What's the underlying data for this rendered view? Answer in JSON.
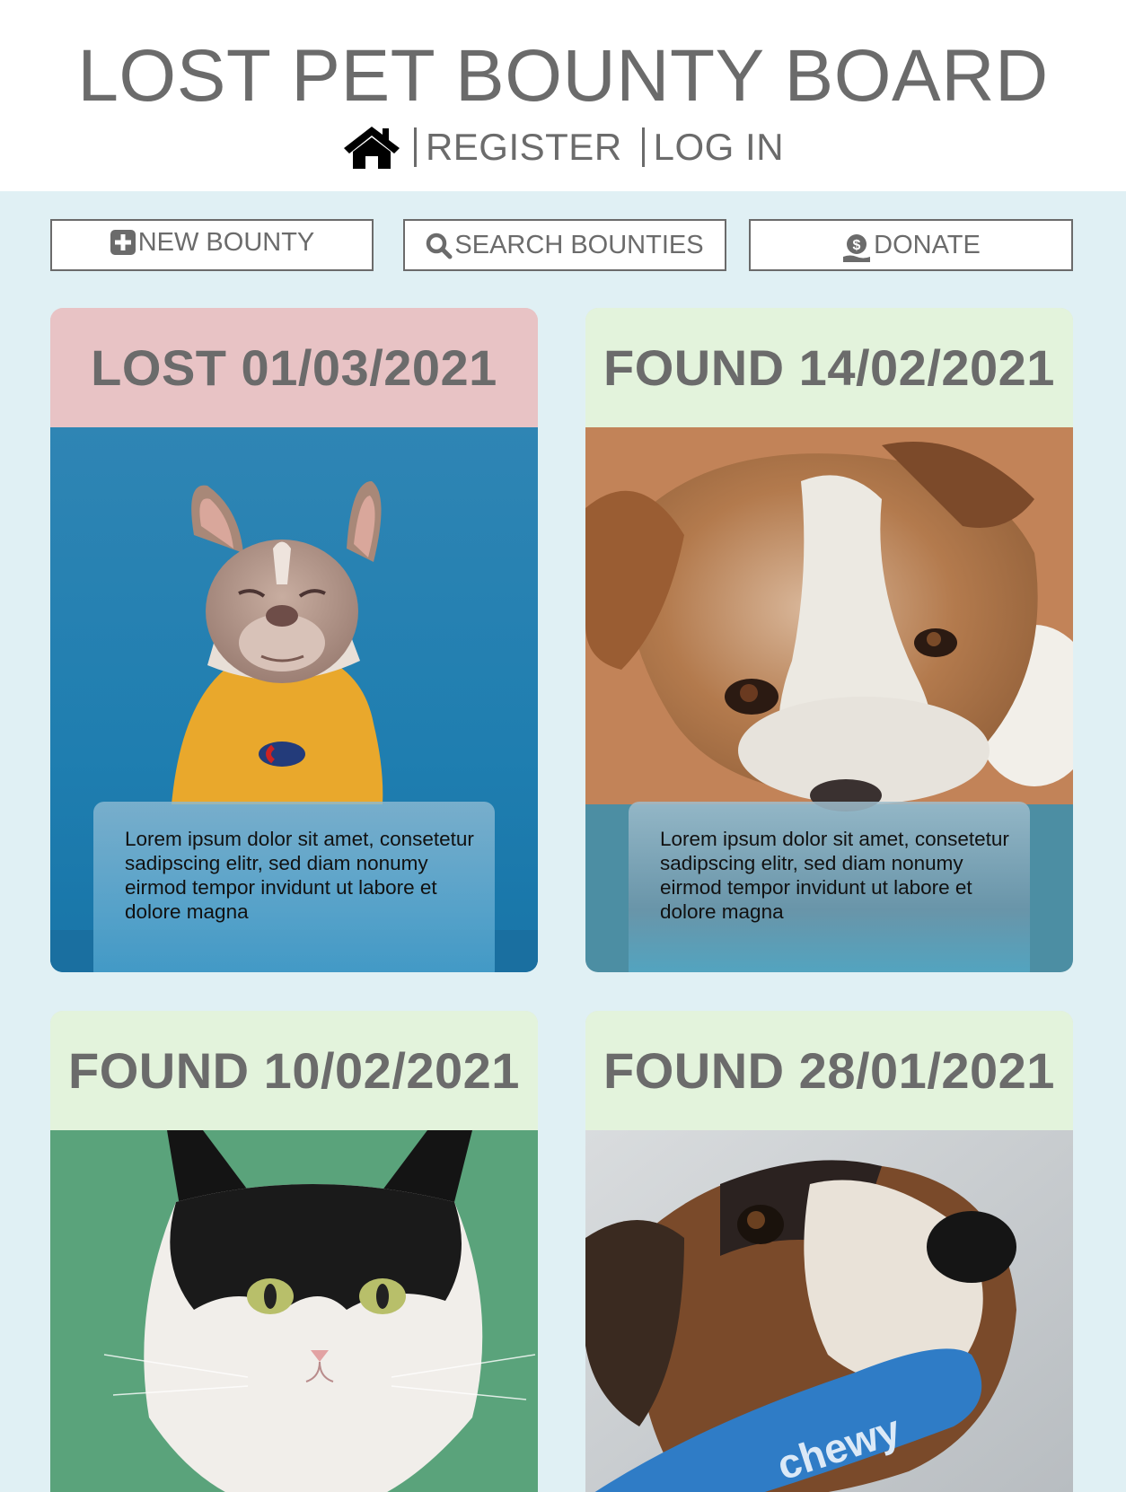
{
  "header": {
    "title": "LOST PET BOUNTY BOARD",
    "nav": {
      "home_icon": "home-icon",
      "register_label": "REGISTER",
      "login_label": "LOG IN"
    }
  },
  "actions": {
    "new_bounty": {
      "label": "NEW BOUNTY",
      "icon": "plus-square-icon"
    },
    "search": {
      "label": "SEARCH BOUNTIES",
      "icon": "magnifier-icon"
    },
    "donate": {
      "label": "DONATE",
      "icon": "dollar-coin-hand-icon"
    }
  },
  "cards": [
    {
      "status": "LOST 01/03/2021",
      "status_color": "#e8c3c5",
      "image": "french-bulldog-yellow-sweater",
      "description": "Lorem ipsum dolor sit amet, consetetur sadipscing elitr, sed diam nonumy eirmod tempor invidunt ut labore et dolore magna"
    },
    {
      "status": "FOUND 14/02/2021",
      "status_color": "#e3f3dc",
      "image": "terrier-lying-down",
      "description": "Lorem ipsum dolor sit amet, consetetur sadipscing elitr, sed diam nonumy eirmod tempor invidunt ut labore et dolore magna"
    },
    {
      "status": "FOUND 10/02/2021",
      "status_color": "#e3f3dc",
      "image": "black-white-cat",
      "photo_text": ""
    },
    {
      "status": "FOUND 28/01/2021",
      "status_color": "#e3f3dc",
      "image": "dog-with-blue-toy",
      "photo_text": "chewy"
    }
  ],
  "colors": {
    "header_bg": "#ffffff",
    "text_gray": "#6b6b6b",
    "main_bg": "#e0f0f4",
    "lost": "#e8c3c5",
    "found": "#e3f3dc"
  }
}
